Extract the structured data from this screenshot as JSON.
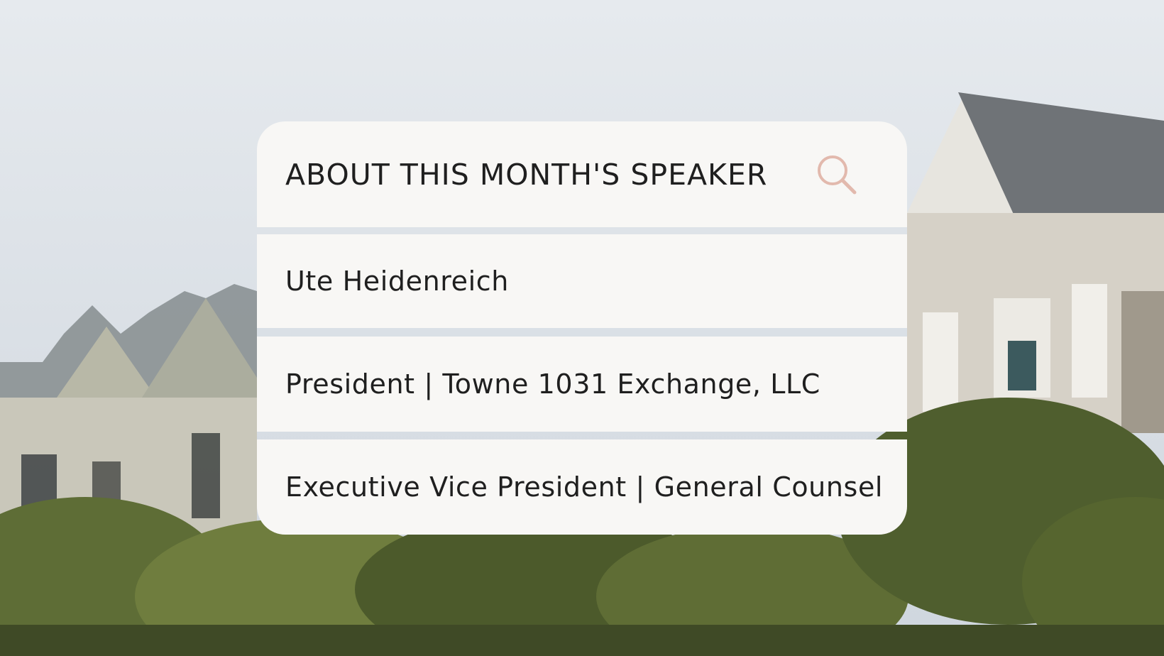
{
  "heading": "ABOUT THIS MONTH'S SPEAKER",
  "speaker_name": "Ute Heidenreich",
  "line_1": "President | Towne 1031 Exchange, LLC",
  "line_2": "Executive Vice President | General Counsel",
  "icons": {
    "title_icon": "search-icon"
  },
  "colors": {
    "card_bg": "#f8f7f5",
    "text": "#1f1f1f",
    "icon_accent": "#e2b9ad",
    "sky": "#dfe4ea"
  }
}
